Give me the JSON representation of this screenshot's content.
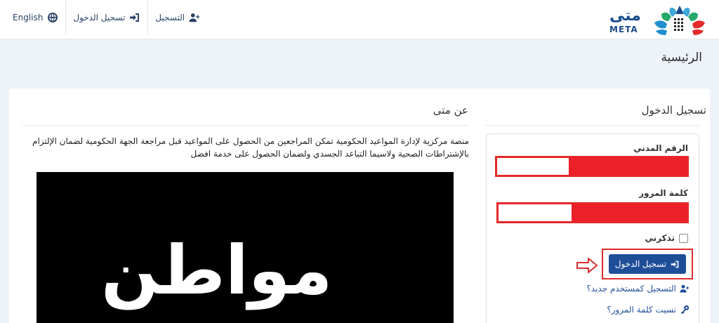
{
  "nav": {
    "english_label": "English",
    "login_label": "تسجيل الدخول",
    "register_label": "التسجيل"
  },
  "logo": {
    "arabic": "متى",
    "english": "META"
  },
  "breadcrumb": {
    "title": "الرئيسية"
  },
  "login": {
    "title": "تسجيل الدخول",
    "civil_id_label": "الرقم المدني",
    "civil_id_value": "",
    "password_label": "كلمة المرور",
    "password_value": "",
    "remember_label": "تذكرني",
    "submit_label": "تسجيل الدخول",
    "register_link": "التسجيل كمستخدم جديد؟",
    "forgot_link": "نسيت كلمة المرور؟"
  },
  "about": {
    "title": "عن متى",
    "description": "منصة مركزية لإدارة المواعيد الحكومية تمكن المراجعين من الحصول على المواعيد قبل مراجعة الجهة الحكومية لضمان الإلتزام بالإشتراطات الصحية ولاسيما التباعد الجسدي ولضمان الحصول على خدمة افضل",
    "image_text": "مواطن"
  },
  "colors": {
    "primary": "#1f4e99",
    "highlight_red": "#e12b2b",
    "text": "#333333"
  }
}
